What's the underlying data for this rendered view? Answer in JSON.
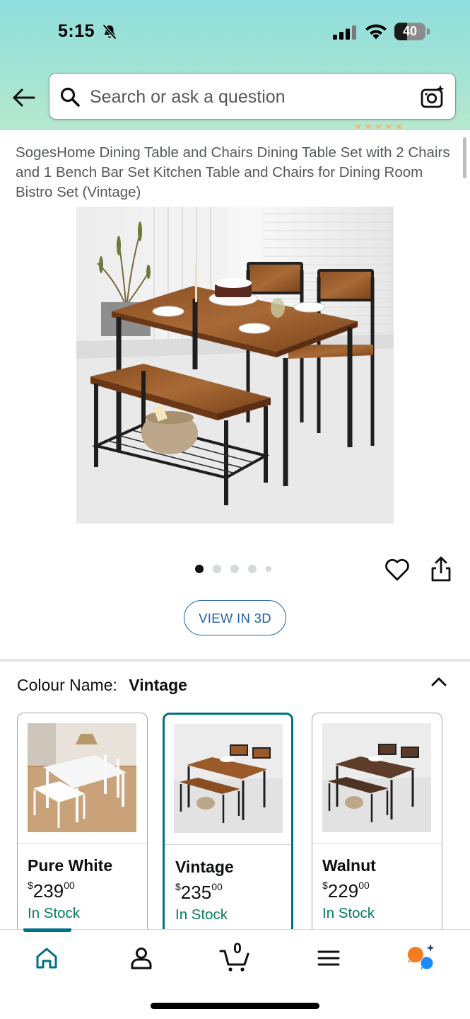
{
  "status_bar": {
    "time": "5:15",
    "battery_level": "40",
    "battery_fraction": 0.4
  },
  "search": {
    "placeholder": "Search or ask a question"
  },
  "product": {
    "title": "SogesHome Dining Table and Chairs Dining Table Set with 2 Chairs and 1 Bench Bar Set Kitchen Table and Chairs for Dining Room Bistro Set (Vintage)",
    "image_count": 5,
    "active_image_index": 0,
    "view_3d_label": "VIEW IN 3D"
  },
  "colour": {
    "label": "Colour Name:",
    "selected": "Vintage",
    "options": [
      {
        "name": "Pure White",
        "currency": "$",
        "whole": "239",
        "fraction": "00",
        "stock": "In Stock",
        "selected": false
      },
      {
        "name": "Vintage",
        "currency": "$",
        "whole": "235",
        "fraction": "00",
        "stock": "In Stock",
        "selected": true
      },
      {
        "name": "Walnut",
        "currency": "$",
        "whole": "229",
        "fraction": "00",
        "stock": "In Stock",
        "selected": false
      }
    ]
  },
  "cart": {
    "count": "0"
  },
  "icons": {
    "back": "arrow-left-icon",
    "search": "search-icon",
    "camera": "camera-sparkle-icon",
    "heart": "heart-icon",
    "share": "share-icon",
    "home": "home-icon",
    "account": "person-icon",
    "cart": "cart-icon",
    "menu": "hamburger-menu-icon",
    "rufus": "rufus-assistant-icon"
  },
  "colors": {
    "header_gradient_top": "#90dede",
    "header_gradient_bottom": "#b7e8cf",
    "accent_teal": "#007185",
    "link_blue": "#2162a1",
    "in_stock_green": "#067d62",
    "rufus_orange": "#f47b20",
    "rufus_blue": "#1a8cff"
  }
}
